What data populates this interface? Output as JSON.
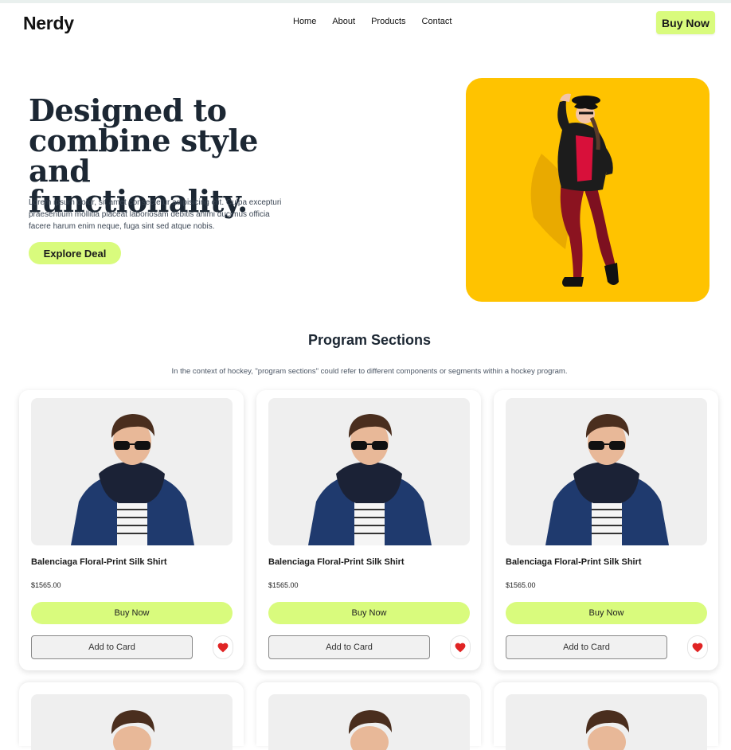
{
  "nav": {
    "brand": "Nerdy",
    "links": [
      "Home",
      "About",
      "Products",
      "Contact"
    ],
    "cta": "Buy Now"
  },
  "hero": {
    "title": "Designed to combine style and functionality.",
    "description": "Lorem ipsum dolor, sit amet consectetur adipisicing elit. Culpa excepturi praesentium mollitia placeat laboriosam debitis animi ducimus officia facere harum enim neque, fuga sint sed atque nobis.",
    "cta": "Explore Deal",
    "image_bg": "#ffc300"
  },
  "section": {
    "title": "Program Sections",
    "subtitle": "In the context of hockey, \"program sections\" could refer to different components or segments within a hockey program."
  },
  "products": [
    {
      "name": "Balenciaga Floral-Print Silk Shirt",
      "price": "$1565.00",
      "buy": "Buy Now",
      "add": "Add to Card",
      "fav_icon": "heart-icon"
    },
    {
      "name": "Balenciaga Floral-Print Silk Shirt",
      "price": "$1565.00",
      "buy": "Buy Now",
      "add": "Add to Card",
      "fav_icon": "heart-icon"
    },
    {
      "name": "Balenciaga Floral-Print Silk Shirt",
      "price": "$1565.00",
      "buy": "Buy Now",
      "add": "Add to Card",
      "fav_icon": "heart-icon"
    }
  ],
  "colors": {
    "accent": "#d9fb7d",
    "heart": "#e02424",
    "text_dark": "#1c2733"
  }
}
